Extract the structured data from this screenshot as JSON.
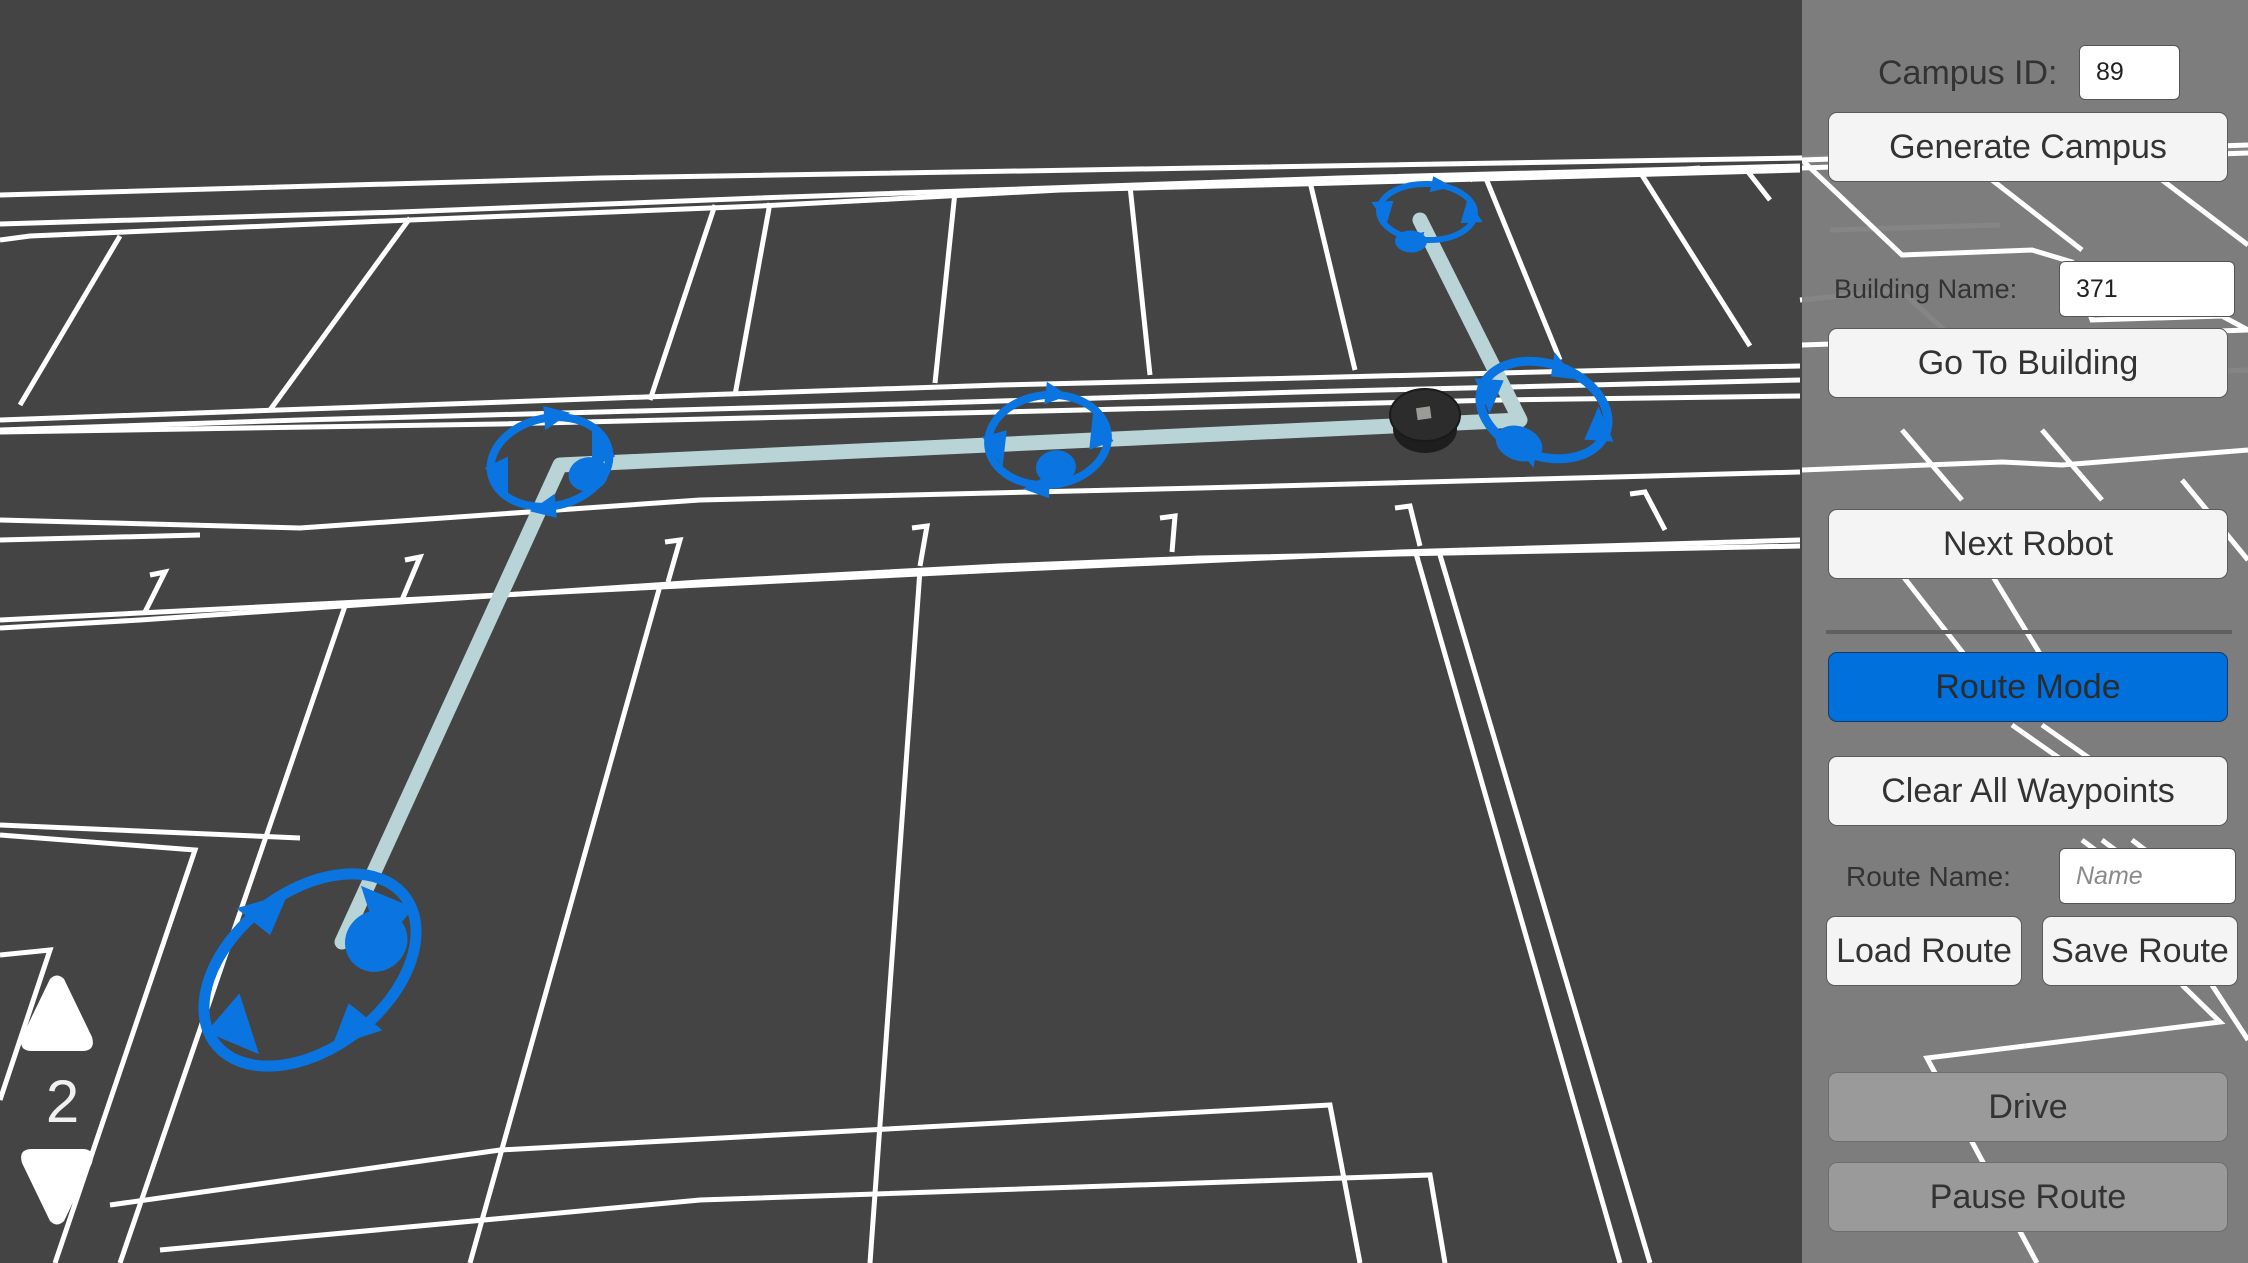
{
  "viewport": {
    "floor_indicator": {
      "current_floor": "2",
      "up_icon": "triangle-up-icon",
      "down_icon": "triangle-down-icon"
    },
    "route_path_color": "#b8d4d6",
    "waypoint_color": "#0a74e0",
    "waypoints": [
      {
        "id": "waypoint-1"
      },
      {
        "id": "waypoint-2"
      },
      {
        "id": "waypoint-3"
      },
      {
        "id": "waypoint-4"
      },
      {
        "id": "waypoint-5"
      }
    ],
    "robot": {
      "name": "robot"
    }
  },
  "panel": {
    "campus_id_label": "Campus ID:",
    "campus_id_value": "89",
    "generate_campus": "Generate Campus",
    "building_name_label": "Building Name:",
    "building_name_value": "371",
    "go_to_building": "Go To Building",
    "next_robot": "Next Robot",
    "route_mode": "Route Mode",
    "clear_all_waypoints": "Clear All Waypoints",
    "route_name_label": "Route Name:",
    "route_name_value": "",
    "route_name_placeholder": "Name",
    "load_route": "Load Route",
    "save_route": "Save Route",
    "drive": "Drive",
    "pause_route": "Pause Route",
    "accent_color": "#0070dc"
  }
}
